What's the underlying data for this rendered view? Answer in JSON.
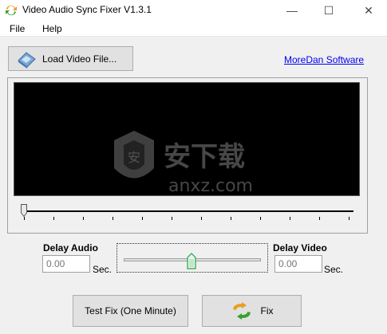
{
  "window": {
    "title": "Video Audio Sync Fixer V1.3.1",
    "controls": {
      "minimize": "—",
      "maximize": "☐",
      "close": "✕"
    }
  },
  "menu": {
    "file": "File",
    "help": "Help"
  },
  "toolbar": {
    "load_label": "Load Video File...",
    "link_label": "MoreDan Software"
  },
  "player": {
    "watermark_text": "安下载",
    "watermark_sub": "anxz.com",
    "seek_position": 0
  },
  "delay": {
    "audio_label": "Delay Audio",
    "audio_value": "0.00",
    "video_label": "Delay Video",
    "video_value": "0.00",
    "unit": "Sec.",
    "slider_position": 0.5
  },
  "actions": {
    "test_label": "Test Fix (One Minute)",
    "fix_label": "Fix"
  },
  "colors": {
    "accent_link": "#0000ee",
    "video_bg": "#000000",
    "thumb_green": "#22a34a"
  }
}
